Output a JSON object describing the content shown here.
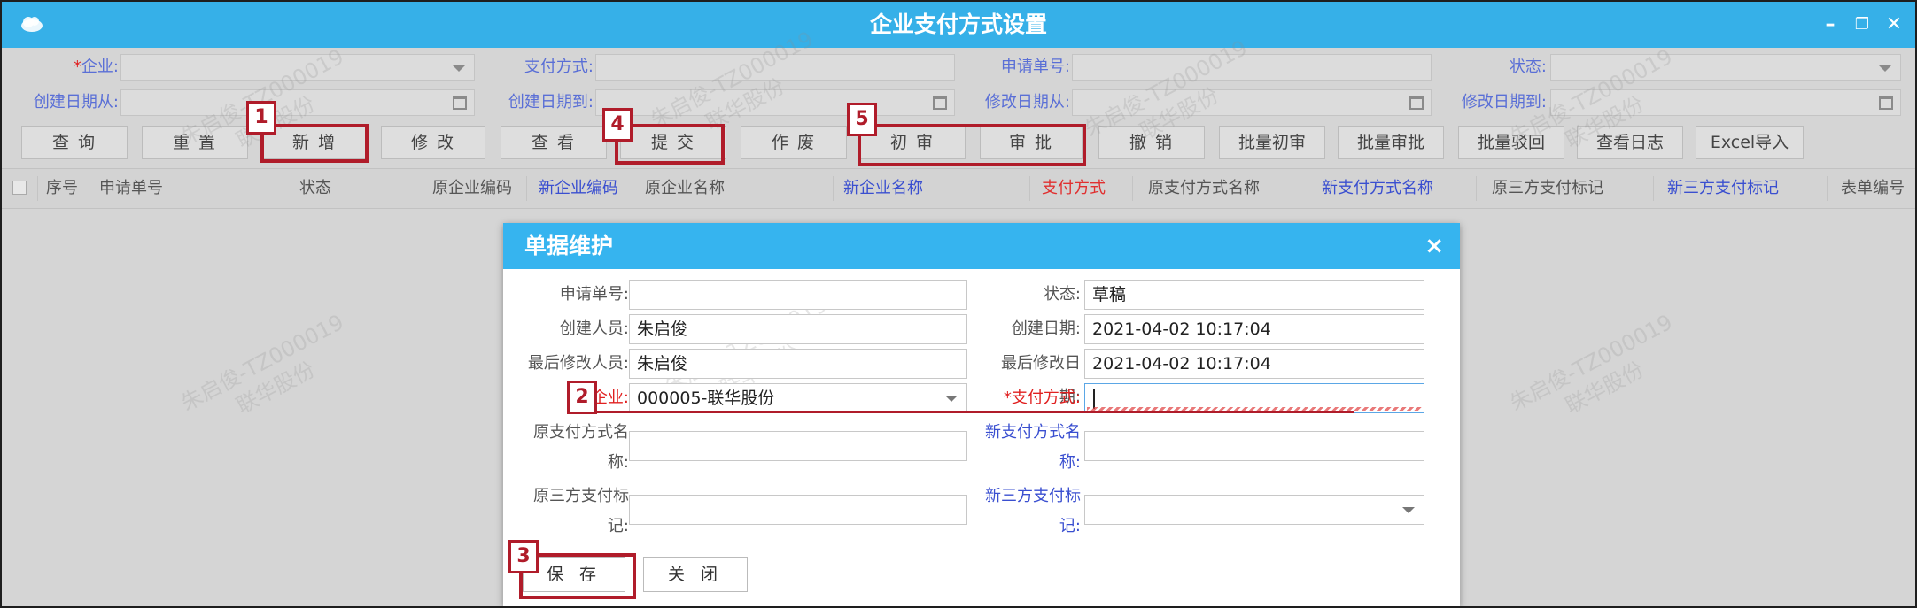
{
  "window": {
    "title": "企业支付方式设置"
  },
  "filters": {
    "row1": [
      {
        "label_req": "*",
        "label": "企业:",
        "type": "select",
        "value": ""
      },
      {
        "label": "支付方式:",
        "type": "text",
        "value": ""
      },
      {
        "label": "申请单号:",
        "type": "text",
        "value": ""
      },
      {
        "label": "状态:",
        "type": "select",
        "value": ""
      }
    ],
    "row2": [
      {
        "label": "创建日期从:",
        "type": "date",
        "value": ""
      },
      {
        "label": "创建日期到:",
        "type": "date",
        "value": ""
      },
      {
        "label": "修改日期从:",
        "type": "date",
        "value": ""
      },
      {
        "label": "修改日期到:",
        "type": "date",
        "value": ""
      }
    ]
  },
  "toolbar": {
    "buttons": [
      "查 询",
      "重 置",
      "新 增",
      "修 改",
      "查 看",
      "提 交",
      "作 废",
      "初 审",
      "审 批",
      "撤 销",
      "批量初审",
      "批量审批",
      "批量驳回",
      "查看日志",
      "Excel导入"
    ]
  },
  "grid": {
    "columns": [
      "序号",
      "申请单号",
      "状态",
      "原企业编码",
      "新企业编码",
      "原企业名称",
      "新企业名称",
      "支付方式",
      "原支付方式名称",
      "新支付方式名称",
      "原三方支付标记",
      "新三方支付标记",
      "表单编号"
    ]
  },
  "watermark": {
    "line1": "朱启俊-TZ000019",
    "line2": "联华股份"
  },
  "dialog": {
    "title": "单据维护",
    "close": "×",
    "fields": {
      "apply_no": {
        "label": "申请单号:",
        "value": ""
      },
      "status": {
        "label": "状态:",
        "value": "草稿"
      },
      "creator": {
        "label": "创建人员:",
        "value": "朱启俊"
      },
      "created_at": {
        "label": "创建日期:",
        "value": "2021-04-02 10:17:04"
      },
      "modifier": {
        "label": "最后修改人员:",
        "value": "朱启俊"
      },
      "modified_at": {
        "label": "最后修改日期:",
        "value": "2021-04-02 10:17:04"
      },
      "company": {
        "label": "企业:",
        "value": "000005-联华股份"
      },
      "pay_method": {
        "label": "*支付方式:",
        "value": ""
      },
      "old_pay_name": {
        "label_1": "原支付方式名",
        "label_2": "称:",
        "value": ""
      },
      "new_pay_name": {
        "label_1": "新支付方式名",
        "label_2": "称:",
        "value": ""
      },
      "old_third": {
        "label_1": "原三方支付标",
        "label_2": "记:",
        "value": ""
      },
      "new_third": {
        "label_1": "新三方支付标",
        "label_2": "记:",
        "value": ""
      }
    },
    "buttons": {
      "save": "保 存",
      "close": "关 闭"
    }
  },
  "annotations": [
    "1",
    "2",
    "3",
    "4",
    "5"
  ]
}
